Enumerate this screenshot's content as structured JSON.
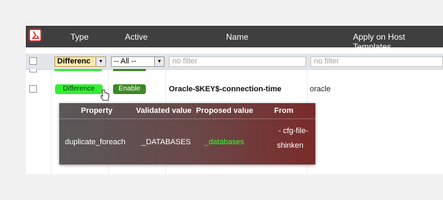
{
  "header": {
    "type": "Type",
    "active": "Active",
    "name": "Name",
    "apply_on": "Apply on Host Templates"
  },
  "filters": {
    "type_value": "Differenc",
    "active_value": "-- All --",
    "name_placeholder": "no filter",
    "apply_placeholder": "no filter"
  },
  "row": {
    "type_badge": "Difference",
    "active_badge": "Enable",
    "name": "Oracle-$KEY$-connection-time",
    "apply_on": "oracle"
  },
  "tooltip": {
    "headers": [
      "Property",
      "Validated value",
      "Proposed value",
      "From"
    ],
    "property": "duplicate_foreach",
    "validated": "_DATABASES",
    "proposed": "_databases",
    "from_line1": "- cfg-file-",
    "from_line2": "shinken"
  },
  "colors": {
    "header_bg": "#3f3f3f",
    "difference_badge": "#33ee33",
    "enable_badge": "#3a8a22",
    "proposed_text": "#33ff33"
  }
}
